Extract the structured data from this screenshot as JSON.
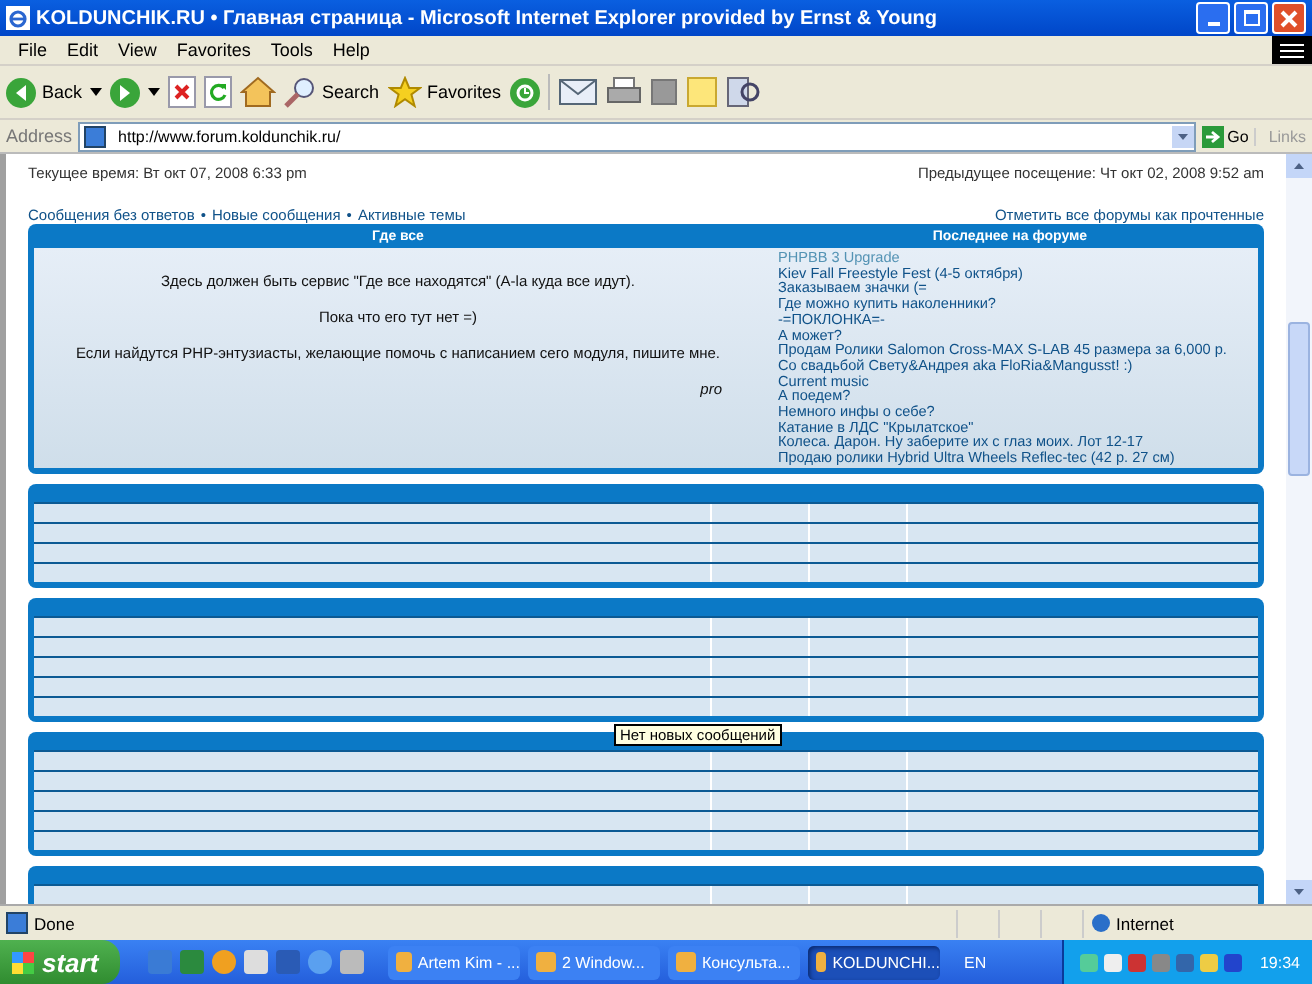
{
  "window": {
    "title": "KOLDUNCHIK.RU • Главная страница - Microsoft Internet Explorer provided by Ernst & Young"
  },
  "menu": [
    "File",
    "Edit",
    "View",
    "Favorites",
    "Tools",
    "Help"
  ],
  "toolbar": {
    "back": "Back",
    "search": "Search",
    "favorites": "Favorites"
  },
  "address": {
    "label": "Address",
    "url": "http://www.forum.koldunchik.ru/",
    "go": "Go",
    "links": "Links"
  },
  "page": {
    "current_time": "Текущее время: Вт окт 07, 2008 6:33 pm",
    "previous_visit": "Предыдущее посещение: Чт окт 02, 2008 9:52 am",
    "links": [
      "Сообщения без ответов",
      "Новые сообщения",
      "Активные темы"
    ],
    "separator": "•",
    "mark_all_read": "Отметить все форумы как прочтенные",
    "box": {
      "columns": [
        "Где все",
        "Последнее на форуме"
      ],
      "paragraphs": [
        "Здесь должен быть сервис \"Где все находятся\" (A-la куда все идут).",
        "Пока что его тут нет =)",
        "Если найдутся PHP-энтузиасты, желающие помочь с написанием сего модуля, пишите мне."
      ],
      "signature": "pro",
      "recent_topics": [
        {
          "title": "PHPBB 3 Upgrade",
          "visited": true
        },
        {
          "title": "Kiev Fall Freestyle Fest (4-5 октября)",
          "visited": false
        },
        {
          "title": "Заказываем значки (=",
          "visited": false
        },
        {
          "title": "Где можно купить наколенники?",
          "visited": false
        },
        {
          "title": "-=ПОКЛОНКА=-",
          "visited": false
        },
        {
          "title": "А может?",
          "visited": false
        },
        {
          "title": "Продам Ролики Salomon Cross-MAX S-LAB 45 размера за 6,000 р.",
          "visited": false
        },
        {
          "title": "Со свадьбой Свету&Андрея aka FloRia&Mangusst! :)",
          "visited": false
        },
        {
          "title": "Current music",
          "visited": false
        },
        {
          "title": "А поедем?",
          "visited": false
        },
        {
          "title": "Немного инфы о себе?",
          "visited": false
        },
        {
          "title": "Катание в ЛДС \"Крылатское\"",
          "visited": false
        },
        {
          "title": "Колеса. Дарон. Ну заберите их с глаз моих. Лот 12-17",
          "visited": false
        },
        {
          "title": "Продаю ролики Hybrid Ultra Wheels Reflec-tec (42 р. 27 см)",
          "visited": false
        }
      ]
    }
  },
  "tooltip": "Нет новых сообщений",
  "status_bar": {
    "text": "Done",
    "zone": "Internet"
  },
  "taskbar": {
    "start": "start",
    "tasks": [
      {
        "label": "Artem Kim - ...",
        "selected": false
      },
      {
        "label": "2 Window...",
        "selected": false
      },
      {
        "label": "Консульта...",
        "selected": false
      },
      {
        "label": "KOLDUNCHI...",
        "selected": true
      }
    ],
    "language": "EN",
    "clock": "19:34"
  }
}
